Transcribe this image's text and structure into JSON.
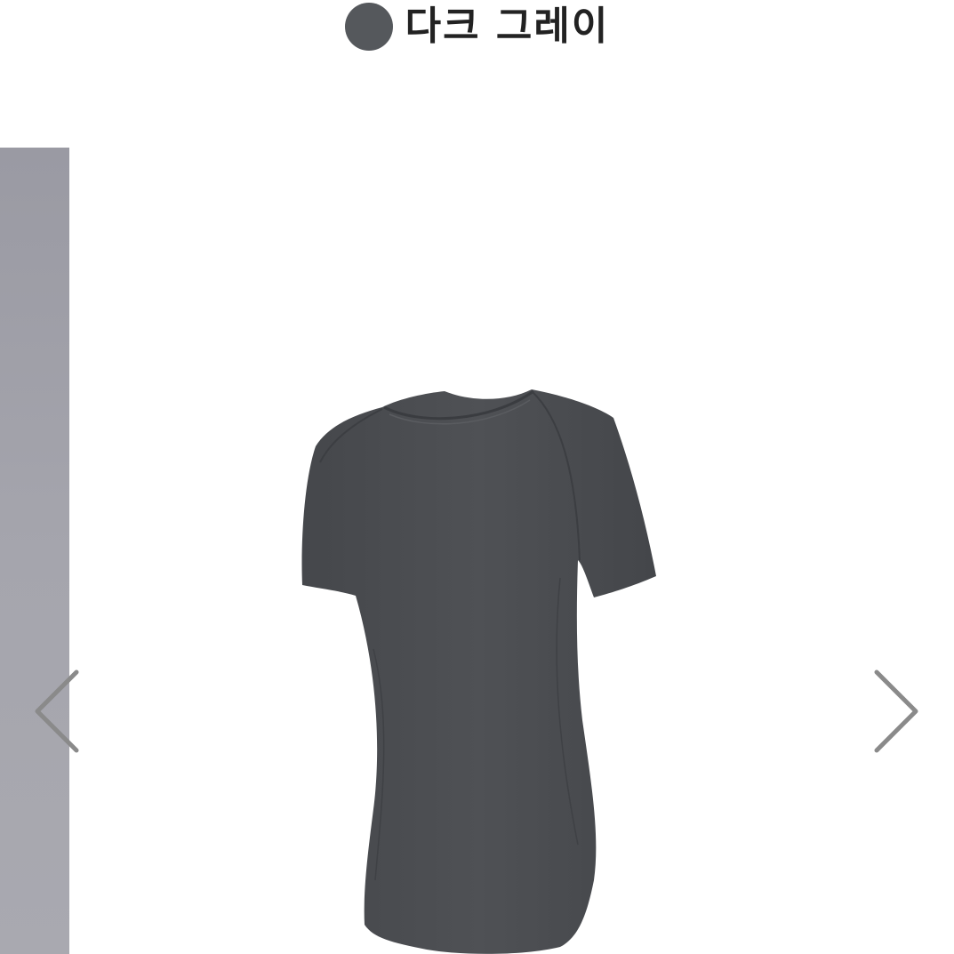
{
  "color_option": {
    "label": "다크 그레이",
    "swatch_color": "#55585c"
  },
  "gallery": {
    "product_color": "#4a4c50",
    "prev_icon": "chevron-left-icon",
    "next_icon": "chevron-right-icon",
    "arrow_color": "#8a8a8a"
  }
}
